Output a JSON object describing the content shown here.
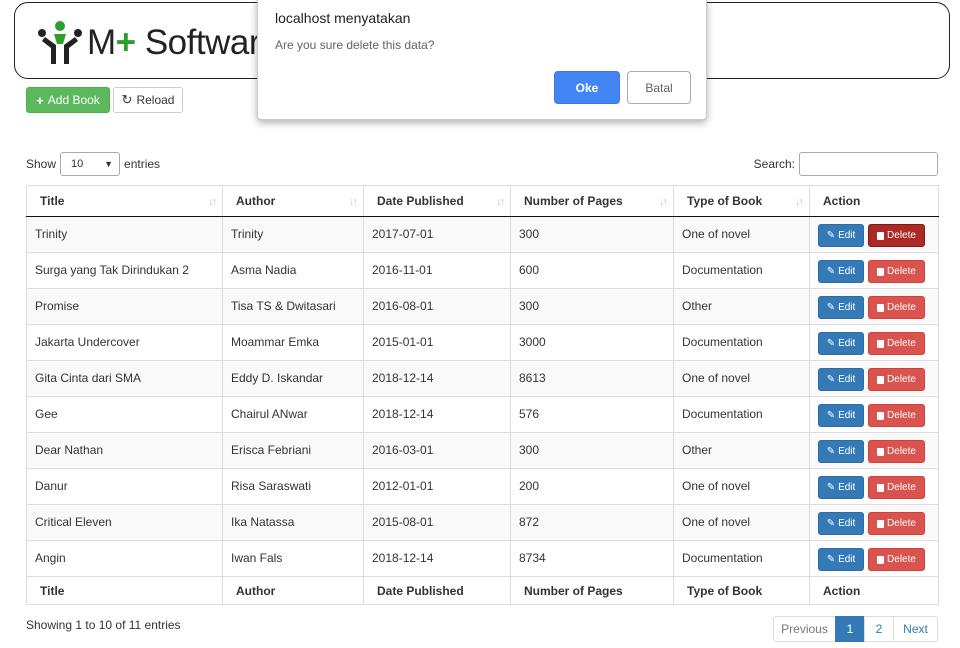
{
  "header": {
    "brand_prefix": "M",
    "brand_plus": "+",
    "brand_suffix": " Software"
  },
  "toolbar": {
    "add_label": "Add Book",
    "reload_label": "Reload"
  },
  "length_menu": {
    "show_label": "Show",
    "value": "10",
    "entries_label": "entries"
  },
  "search": {
    "label": "Search:",
    "value": ""
  },
  "table": {
    "columns": [
      "Title",
      "Author",
      "Date Published",
      "Number of Pages",
      "Type of Book",
      "Action"
    ],
    "rows": [
      [
        "Trinity",
        "Trinity",
        "2017-07-01",
        "300",
        "One of novel"
      ],
      [
        "Surga yang Tak Dirindukan 2",
        "Asma Nadia",
        "2016-11-01",
        "600",
        "Documentation"
      ],
      [
        "Promise",
        "Tisa TS & Dwitasari",
        "2016-08-01",
        "300",
        "Other"
      ],
      [
        "Jakarta Undercover",
        "Moammar Emka",
        "2015-01-01",
        "3000",
        "Documentation"
      ],
      [
        "Gita Cinta dari SMA",
        "Eddy D. Iskandar",
        "2018-12-14",
        "8613",
        "One of novel"
      ],
      [
        "Gee",
        "Chairul ANwar",
        "2018-12-14",
        "576",
        "Documentation"
      ],
      [
        "Dear Nathan",
        "Erisca Febriani",
        "2016-03-01",
        "300",
        "Other"
      ],
      [
        "Danur",
        "Risa Saraswati",
        "2012-01-01",
        "200",
        "One of novel"
      ],
      [
        "Critical Eleven",
        "Ika Natassa",
        "2015-08-01",
        "872",
        "One of novel"
      ],
      [
        "Angin",
        "Iwan Fals",
        "2018-12-14",
        "8734",
        "Documentation"
      ]
    ],
    "edit_label": "Edit",
    "delete_label": "Delete"
  },
  "info": "Showing 1 to 10 of 11 entries",
  "pagination": {
    "previous": "Previous",
    "pages": [
      "1",
      "2"
    ],
    "next": "Next"
  },
  "dialog": {
    "title": "localhost menyatakan",
    "message": "Are you sure delete this data?",
    "ok": "Oke",
    "cancel": "Batal"
  },
  "colors": {
    "primary": "#337ab7",
    "success": "#5cb85c",
    "danger": "#d9534f",
    "danger_pressed": "#ac2925",
    "dialog_ok": "#4285f4",
    "logo_green": "#2e9e2e"
  }
}
